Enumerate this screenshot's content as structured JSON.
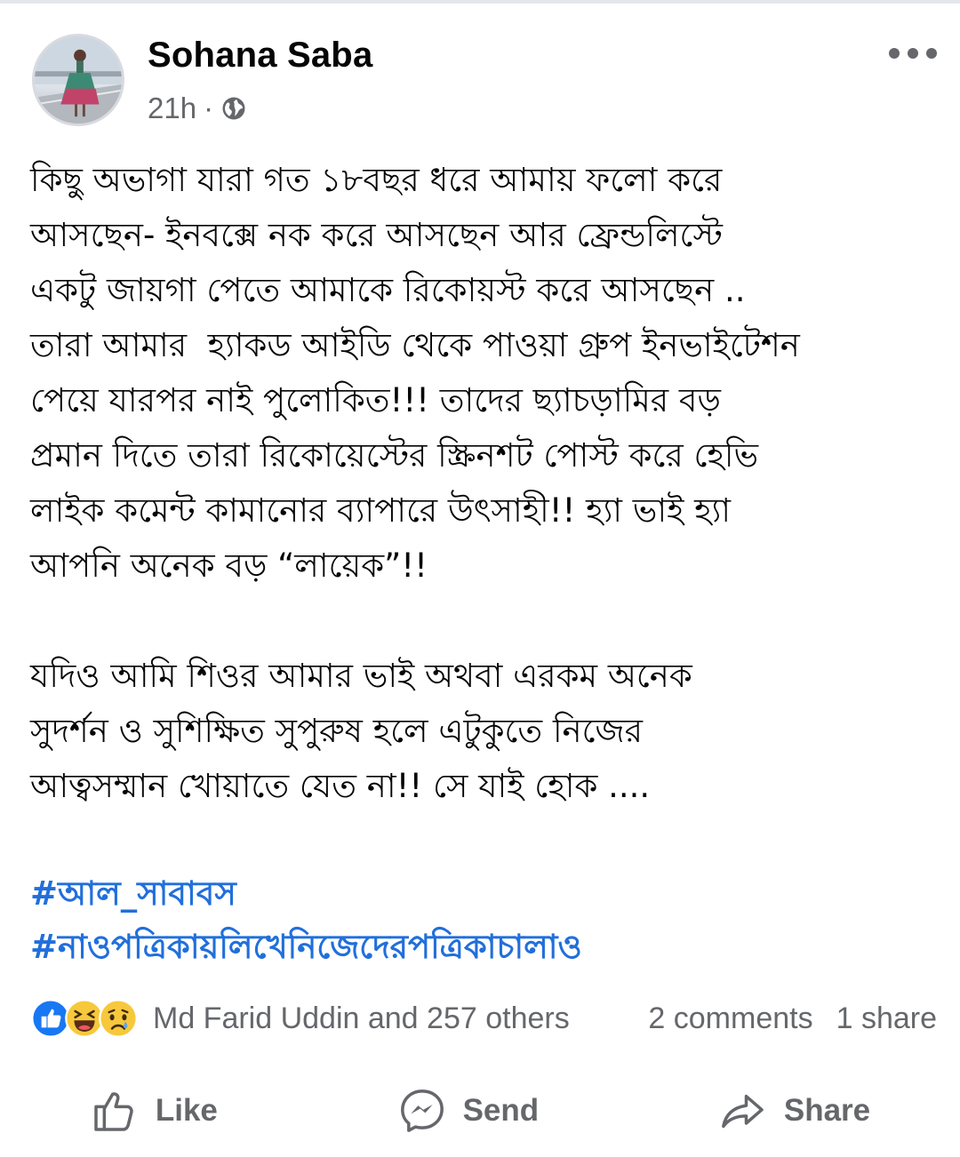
{
  "post": {
    "author": "Sohana Saba",
    "time": "21h",
    "separator": "·",
    "visibility_icon": "globe-icon",
    "more_icon": "more-options-icon",
    "paragraphs": [
      "কিছু অভাগা যারা গত ১৮বছর ধরে আমায় ফলো করে\nআসছেন- ইনবক্সে নক করে আসছেন আর ফ্রেন্ডলিস্টে\nএকটু জায়গা পেতে আমাকে রিকোয়স্ট করে আসছেন ..\nতারা আমার  হ্যাকড আইডি থেকে পাওয়া গ্রুপ ইনভাইটেশন\nপেয়ে যারপর নাই পুলোকিত!!! তাদের ছ্যাচড়ামির বড়\nপ্রমান দিতে তারা রিকোয়েস্টের স্ক্রিনশট পোস্ট করে হেভি\nলাইক কমেন্ট কামানোর ব্যাপারে উৎসাহী!! হ্যা ভাই হ্যা\nআপনি অনেক বড় “লায়েক”!!",
      "যদিও আমি শিওর আমার ভাই অথবা এরকম অনেক\nসুদর্শন ও সুশিক্ষিত সুপুরুষ হলে এটুকুতে নিজের\nআত্বসম্মান খোয়াতে যেত না!! সে যাই হোক ...."
    ],
    "hashtags": [
      "#আল_সাবাবস",
      "#নাওপত্রিকায়লিখেনিজেদেরপত্রিকাচালাও"
    ]
  },
  "reactions": {
    "icons": [
      "like-reaction-icon",
      "haha-reaction-icon",
      "sad-reaction-icon"
    ],
    "text": "Md Farid Uddin and 257 others",
    "comments": "2 comments",
    "shares": "1 share"
  },
  "actions": {
    "like": "Like",
    "send": "Send",
    "share": "Share"
  },
  "colors": {
    "hashtag": "#216fdb",
    "secondary_text": "#65676b",
    "like_blue": "#1877f2"
  }
}
